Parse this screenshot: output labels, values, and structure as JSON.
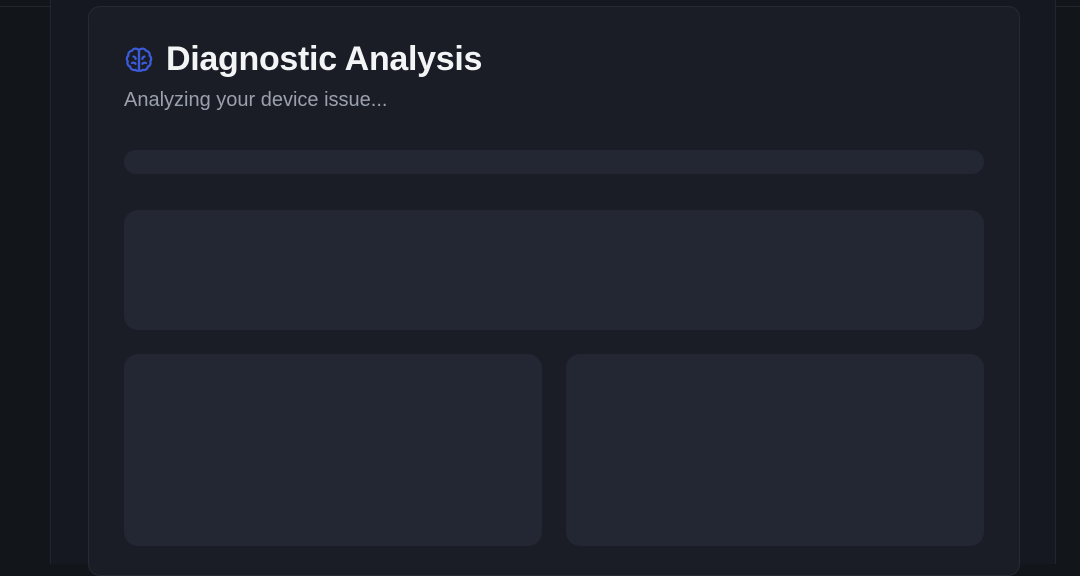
{
  "diagnostic": {
    "icon": "brain-icon",
    "title": "Diagnostic Analysis",
    "subtitle": "Analyzing your device issue..."
  },
  "colors": {
    "accent": "#3b5bdb",
    "background": "#121519",
    "card": "#1a1d25",
    "skeleton": "#222733",
    "title_text": "#f3f4f6",
    "subtitle_text": "#9aa1ad"
  }
}
